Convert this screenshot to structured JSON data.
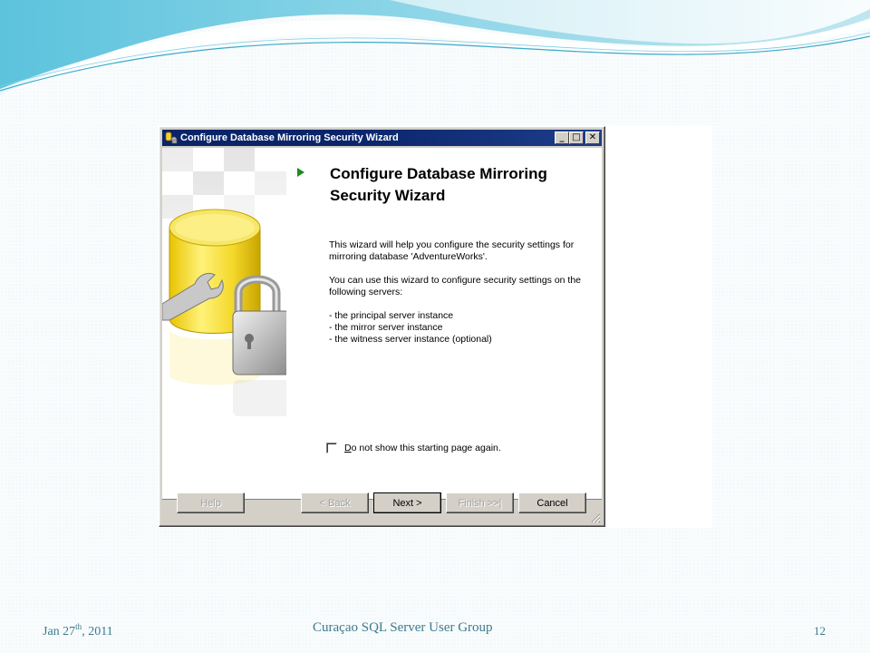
{
  "window": {
    "title": "Configure Database Mirroring Security Wizard",
    "minimize_glyph": "_",
    "maximize_glyph": "□",
    "close_glyph": "✕"
  },
  "wizard": {
    "heading": "Configure Database Mirroring Security Wizard",
    "intro": "This wizard will help you configure the security settings for mirroring database 'AdventureWorks'.",
    "usage": "You can use this wizard to configure security settings on the following servers:",
    "servers": [
      "- the principal server instance",
      "- the mirror server instance",
      "- the witness server instance (optional)"
    ],
    "checkbox": {
      "label_accel": "D",
      "label_rest": "o not show this starting page again.",
      "checked": false
    }
  },
  "buttons": {
    "help": "Help",
    "back": "< Back",
    "next": "Next >",
    "finish": "Finish >>|",
    "cancel": "Cancel"
  },
  "footer": {
    "date_prefix": "Jan 27",
    "date_sup": "th",
    "date_suffix": ", 2011",
    "center": "Curaçao SQL Server User Group",
    "page": "12"
  },
  "icons": {
    "app": "wizard-app-icon",
    "art": "database-wrench-lock-illustration",
    "step_marker": "green-arrow-icon"
  },
  "colors": {
    "titlebar": "#0a246a",
    "window_face": "#d4d0c8",
    "footer_text": "#3d7a8c",
    "wave_light": "#bfe6f0",
    "wave_dark": "#46b8d6",
    "arrow_green": "#1f8a1f"
  }
}
